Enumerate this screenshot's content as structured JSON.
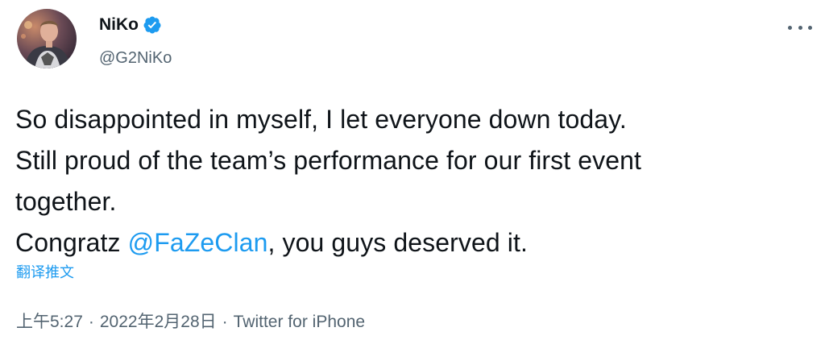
{
  "author": {
    "display_name": "NiKo",
    "handle": "@G2NiKo",
    "verified": true,
    "avatar_icon": "avatar-photo"
  },
  "menu": {
    "icon": "more-options-icon"
  },
  "tweet": {
    "lines": [
      {
        "text": "So disappointed in myself, I let everyone down today."
      },
      {
        "text": "Still proud of the team’s performance for our first event"
      },
      {
        "text": "together."
      }
    ],
    "last_line": {
      "before": "Congratz ",
      "mention": "@FaZeClan",
      "after": ", you guys deserved it."
    },
    "translate_label": "翻译推文"
  },
  "meta": {
    "time": "上午5:27",
    "separator": "·",
    "date": "2022年2月28日",
    "source": "Twitter for iPhone"
  },
  "colors": {
    "text": "#0f1419",
    "secondary": "#536471",
    "link": "#1d9bf0",
    "verified": "#1d9bf0"
  }
}
